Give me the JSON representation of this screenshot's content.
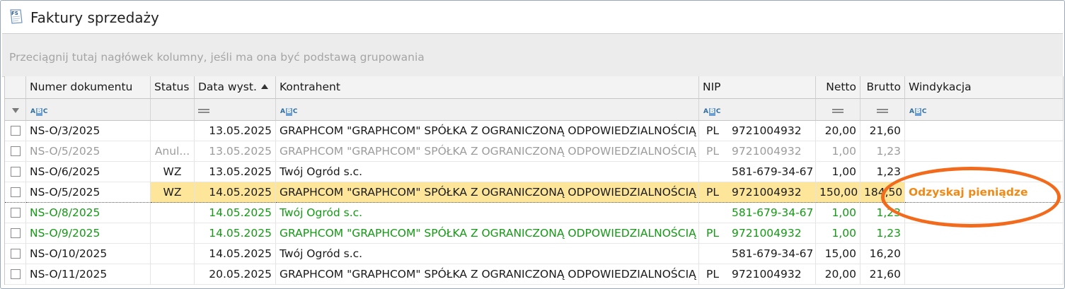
{
  "window": {
    "icon_label": "FS",
    "title": "Faktury sprzedaży"
  },
  "group_panel": {
    "hint": "Przeciągnij tutaj nagłówek kolumny, jeśli ma ona być podstawą grupowania"
  },
  "columns": {
    "number": "Numer dokumentu",
    "status": "Status",
    "date": "Data wyst.",
    "contractor": "Kontrahent",
    "nip": "NIP",
    "net": "Netto",
    "gross": "Brutto",
    "collection": "Windykacja"
  },
  "filter_icons": {
    "select": "filter-funnel-icon",
    "number": "text-filter-icon",
    "date": "equals-filter-icon",
    "contractor": "text-filter-icon",
    "nip": "text-filter-icon",
    "net": "equals-filter-icon",
    "gross": "equals-filter-icon",
    "collection": "text-filter-icon"
  },
  "rows": [
    {
      "number": "NS-O/3/2025",
      "status": "",
      "date": "13.05.2025",
      "contractor": "GRAPHCOM \"GRAPHCOM\" SPÓŁKA Z OGRANICZONĄ ODPOWIEDZIALNOŚCIĄ",
      "nip_prefix": "PL",
      "nip": "9721004932",
      "net": "20,00",
      "gross": "21,60",
      "collection": ""
    },
    {
      "number": "NS-O/5/2025",
      "status": "Anul...",
      "date": "13.05.2025",
      "contractor": "GRAPHCOM \"GRAPHCOM\" SPÓŁKA Z OGRANICZONĄ ODPOWIEDZIALNOŚCIĄ",
      "nip_prefix": "PL",
      "nip": "9721004932",
      "net": "1,00",
      "gross": "1,23",
      "collection": ""
    },
    {
      "number": "NS-O/6/2025",
      "status": "WZ",
      "date": "13.05.2025",
      "contractor": "Twój Ogród s.c.",
      "nip_prefix": "",
      "nip": "581-679-34-67",
      "net": "1,00",
      "gross": "1,23",
      "collection": ""
    },
    {
      "number": "NS-O/5/2025",
      "status": "WZ",
      "date": "14.05.2025",
      "contractor": "GRAPHCOM \"GRAPHCOM\" SPÓŁKA Z OGRANICZONĄ ODPOWIEDZIALNOŚCIĄ",
      "nip_prefix": "PL",
      "nip": "9721004932",
      "net": "150,00",
      "gross": "184,50",
      "collection": "Odzyskaj pieniądze"
    },
    {
      "number": "NS-O/8/2025",
      "status": "",
      "date": "14.05.2025",
      "contractor": "Twój Ogród s.c.",
      "nip_prefix": "",
      "nip": "581-679-34-67",
      "net": "1,00",
      "gross": "1,23",
      "collection": ""
    },
    {
      "number": "NS-O/9/2025",
      "status": "",
      "date": "14.05.2025",
      "contractor": "GRAPHCOM \"GRAPHCOM\" SPÓŁKA Z OGRANICZONĄ ODPOWIEDZIALNOŚCIĄ",
      "nip_prefix": "PL",
      "nip": "9721004932",
      "net": "1,00",
      "gross": "1,23",
      "collection": ""
    },
    {
      "number": "NS-O/10/2025",
      "status": "",
      "date": "14.05.2025",
      "contractor": "Twój Ogród s.c.",
      "nip_prefix": "",
      "nip": "581-679-34-67",
      "net": "15,00",
      "gross": "16,20",
      "collection": ""
    },
    {
      "number": "NS-O/11/2025",
      "status": "",
      "date": "20.05.2025",
      "contractor": "GRAPHCOM \"GRAPHCOM\" SPÓŁKA Z OGRANICZONĄ ODPOWIEDZIALNOŚCIĄ",
      "nip_prefix": "PL",
      "nip": "9721004932",
      "net": "20,00",
      "gross": "21,60",
      "collection": ""
    }
  ],
  "colors": {
    "selected_row": "#fde59a",
    "cancelled_text": "#9c9c9c",
    "green_text": "#149a14",
    "collection_link": "#f08a16",
    "highlight_ellipse": "#f26b1d"
  }
}
